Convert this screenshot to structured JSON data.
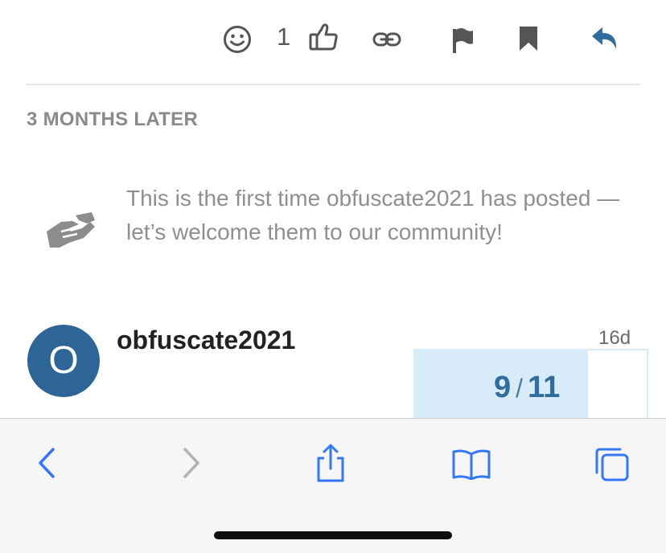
{
  "post_actions": {
    "like_count": "1",
    "icons": [
      "emoji-icon",
      "thumbs-up-icon",
      "link-icon",
      "flag-icon",
      "bookmark-icon",
      "reply-icon"
    ]
  },
  "time_gap": {
    "label": "3 MONTHS LATER"
  },
  "welcome_notice": {
    "text": "This is the first time obfuscate2021 has posted — let’s welcome them to our community!",
    "icon": "handshake-icon"
  },
  "post": {
    "avatar_letter": "O",
    "username": "obfuscate2021",
    "age": "16d"
  },
  "timeline": {
    "current": "9",
    "separator": "/",
    "total": "11",
    "progress_fraction": 0.745
  },
  "browser_toolbar": {
    "icons": [
      "back-icon",
      "forward-icon",
      "share-icon",
      "bookmarks-icon",
      "tabs-icon"
    ]
  },
  "colors": {
    "accent": "#2f6d9e",
    "avatar_bg": "#2d6596",
    "timeline_bg": "#d7ebf8",
    "ios_blue": "#3478f6",
    "muted_text": "#8f8f8f"
  }
}
